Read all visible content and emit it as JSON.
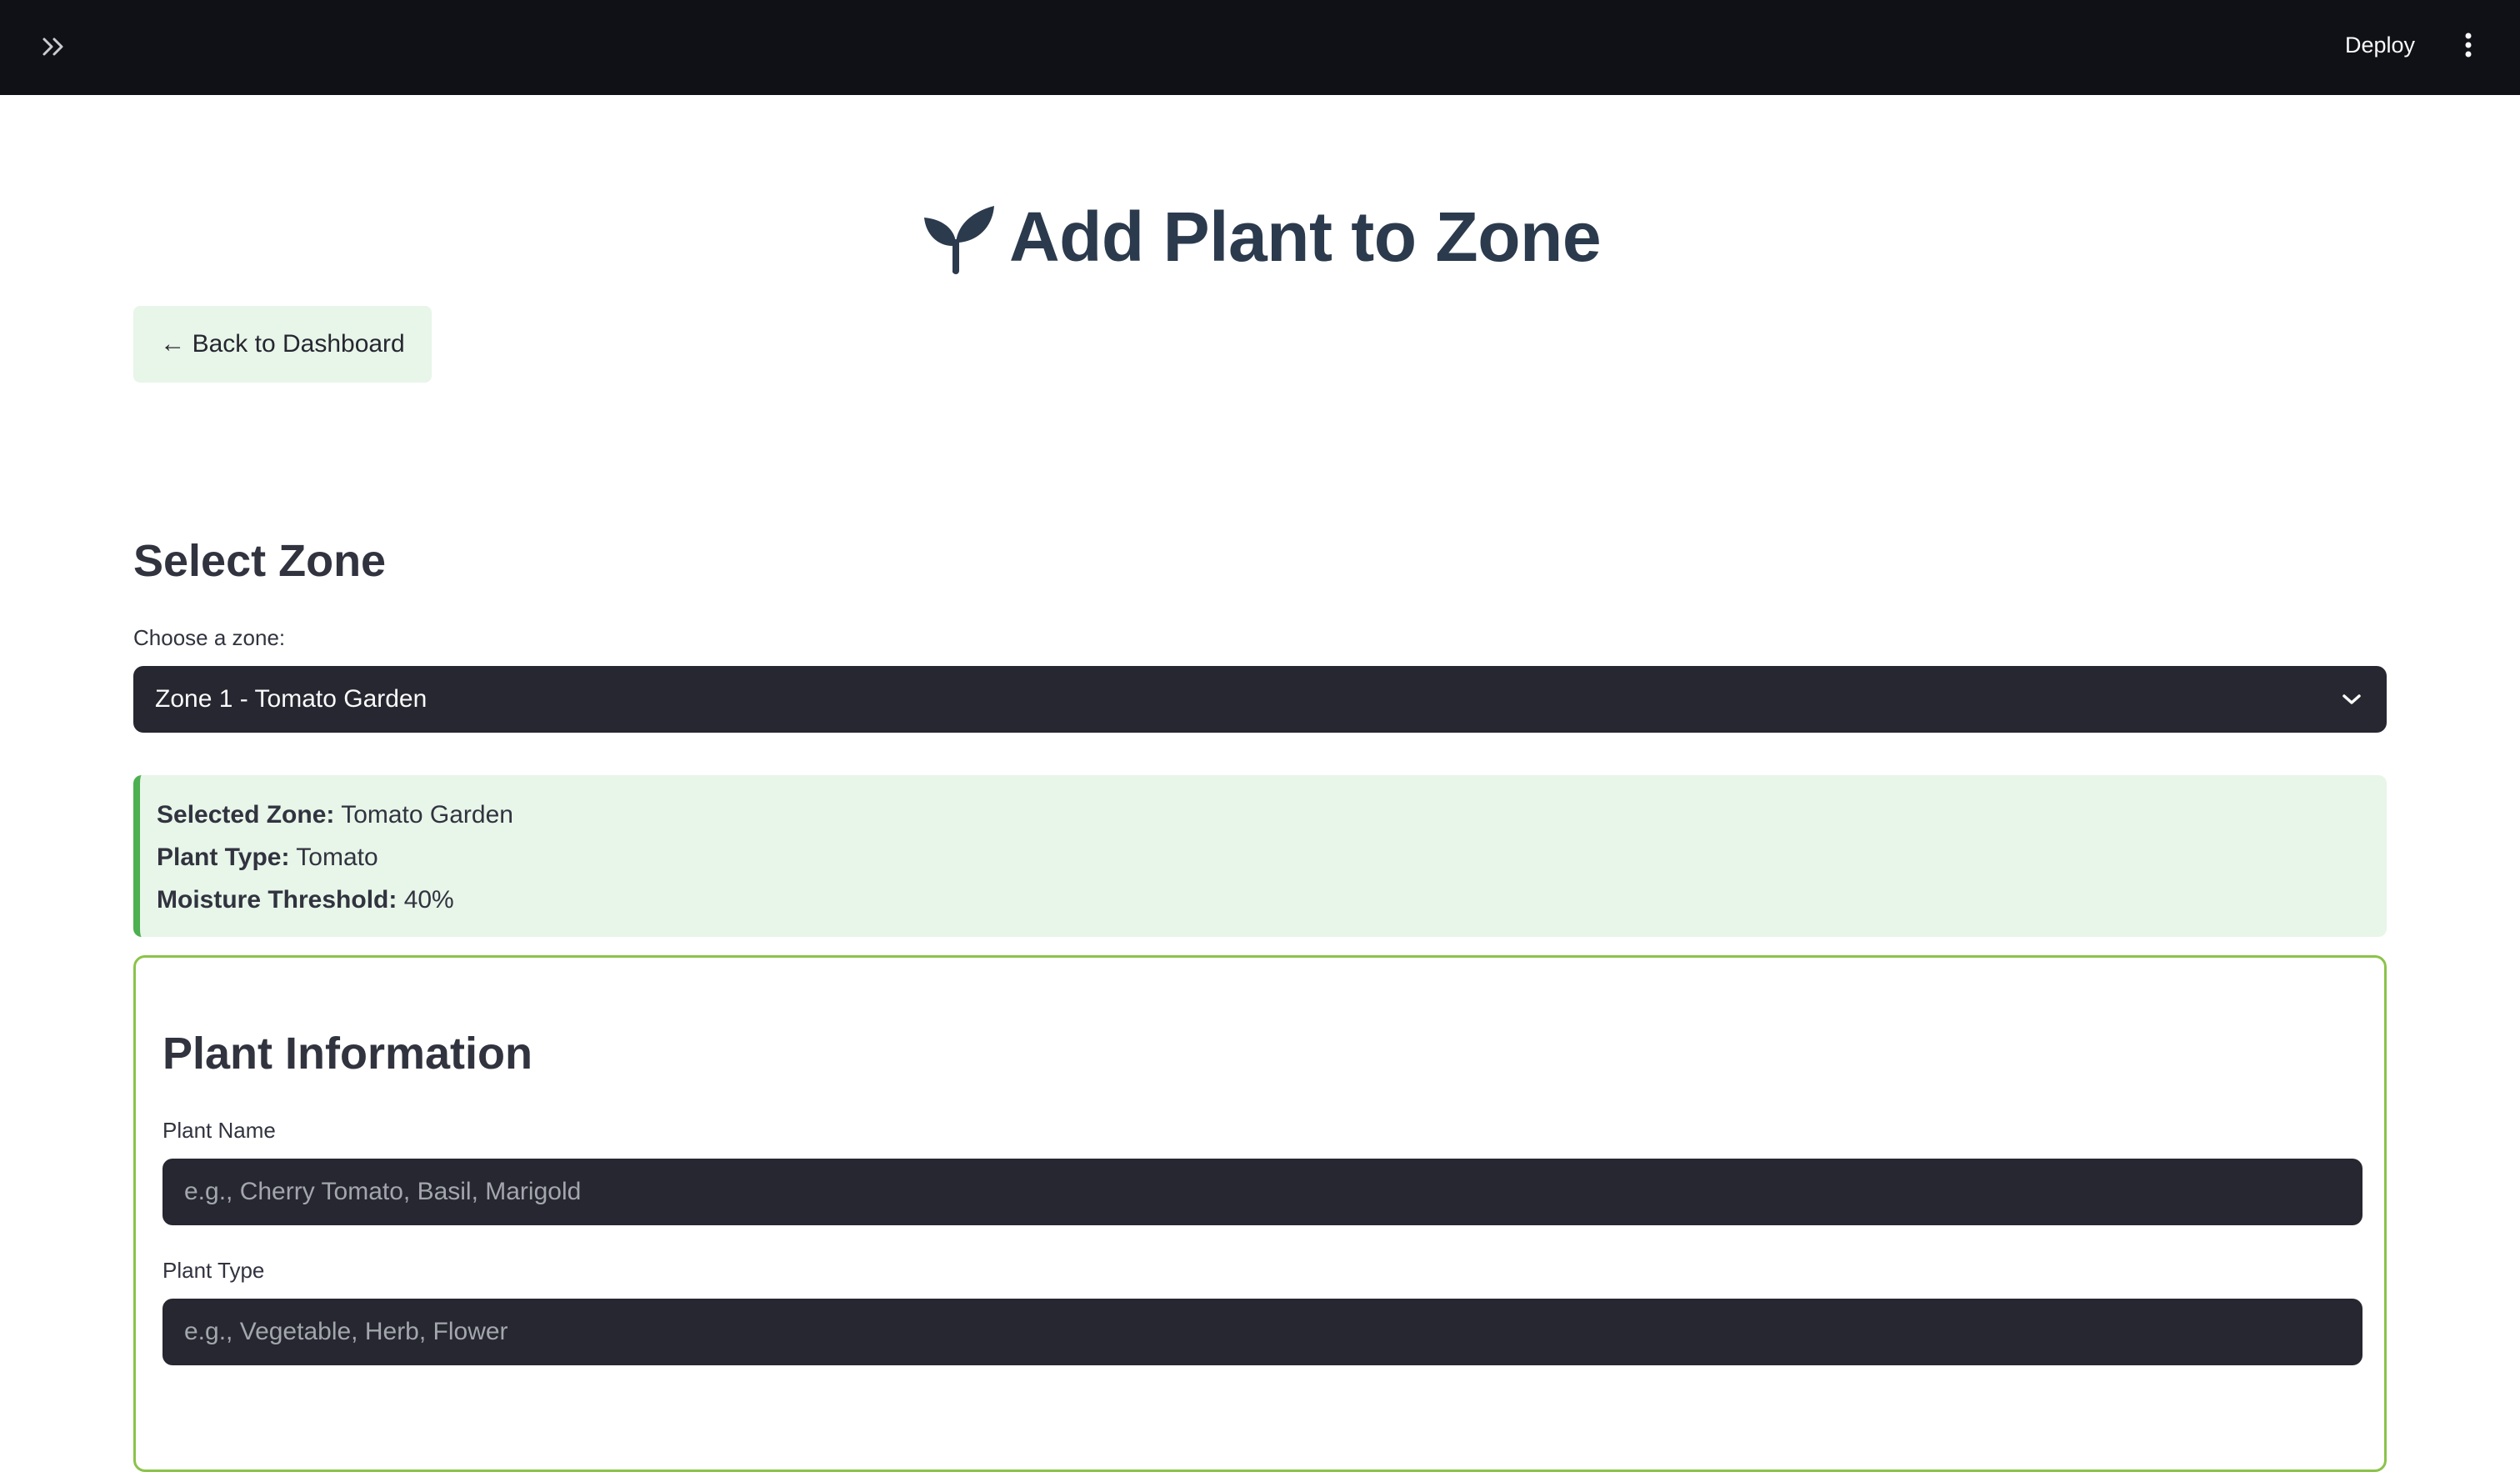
{
  "header": {
    "deploy_label": "Deploy",
    "sidebar_toggle_icon": "double-chevron-right-icon",
    "menu_icon": "vertical-ellipsis-icon"
  },
  "page": {
    "title": "Add Plant to Zone",
    "title_icon": "seedling-icon",
    "back_button_label": "← Back to Dashboard"
  },
  "zone_section": {
    "heading": "Select Zone",
    "select_label": "Choose a zone:",
    "selected_value": "Zone 1 - Tomato Garden"
  },
  "zone_info": {
    "selected_zone_label": "Selected Zone:",
    "selected_zone_value": "Tomato Garden",
    "plant_type_label": "Plant Type:",
    "plant_type_value": "Tomato",
    "moisture_label": "Moisture Threshold:",
    "moisture_value": "40%"
  },
  "plant_form": {
    "heading": "Plant Information",
    "name_label": "Plant Name",
    "name_placeholder": "e.g., Cherry Tomato, Basil, Marigold",
    "type_label": "Plant Type",
    "type_placeholder": "e.g., Vegetable, Herb, Flower"
  },
  "colors": {
    "header_bg": "#0f1117",
    "accent_green": "#4caf50",
    "info_bg": "#e8f5e9",
    "card_border": "#8bc34a",
    "input_bg": "#262730",
    "title_color": "#2b3a4d"
  }
}
